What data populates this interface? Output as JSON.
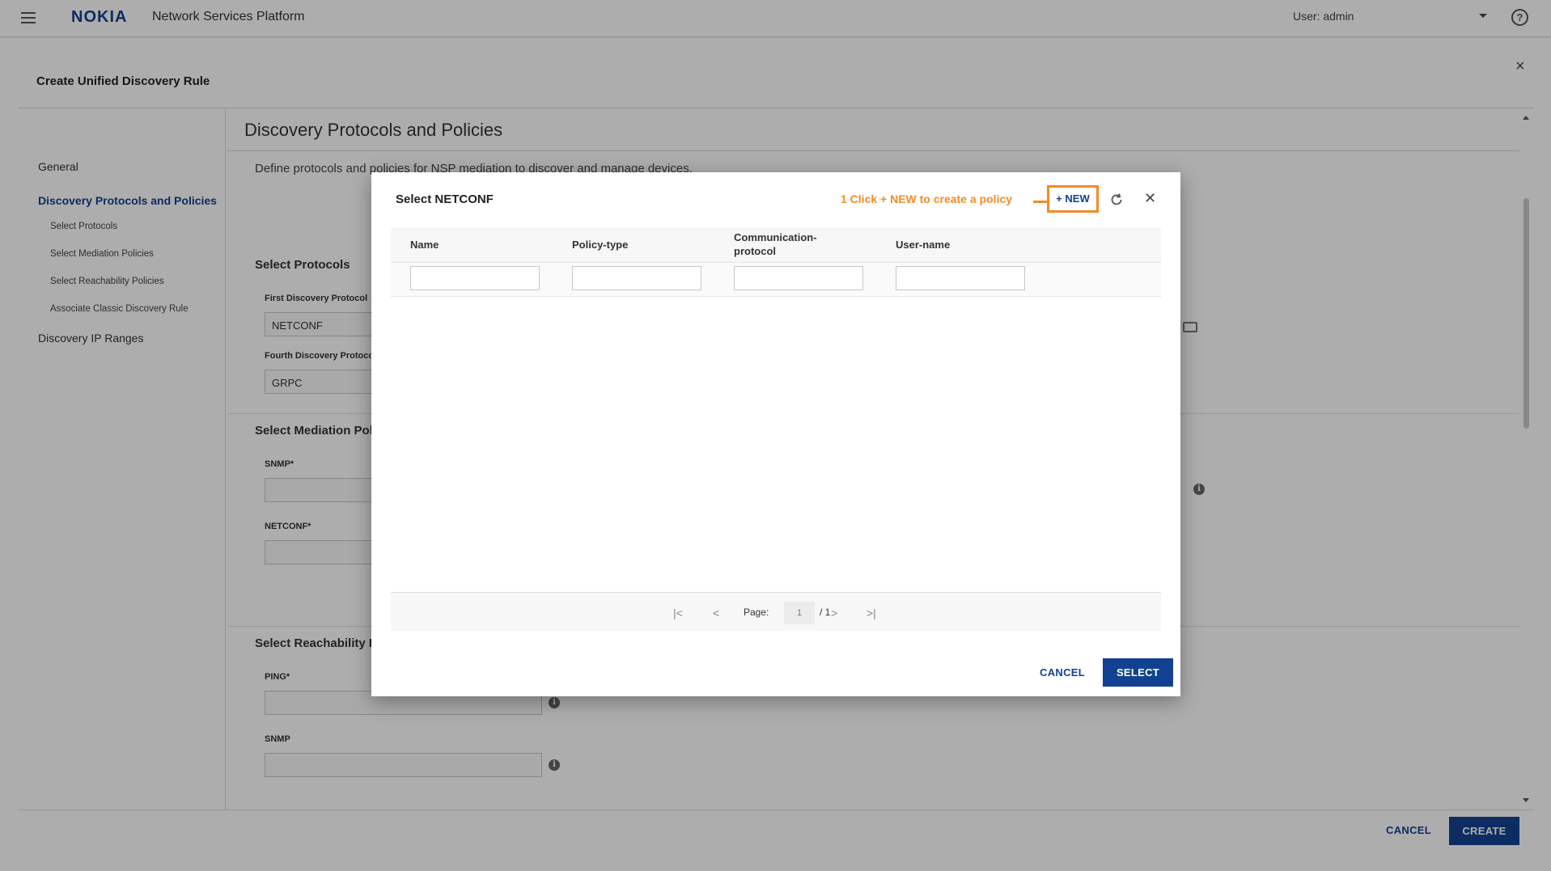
{
  "header": {
    "logo": "NOKIA",
    "app_title": "Network Services Platform",
    "user": "User: admin",
    "help": "?"
  },
  "dialog": {
    "title": "Create Unified Discovery Rule",
    "close": "×",
    "nav": {
      "general": "General",
      "protocols": "Discovery Protocols and Policies",
      "sub_select_protocols": "Select Protocols",
      "sub_mediation": "Select Mediation Policies",
      "sub_reachability": "Select Reachability Policies",
      "sub_classic": "Associate Classic Discovery Rule",
      "ip_ranges": "Discovery IP Ranges"
    },
    "section_title": "Discovery Protocols and Policies",
    "section_desc": "Define protocols and policies for NSP mediation to discover and manage devices.",
    "select_protocols": {
      "title": "Select Protocols",
      "first_label": "First Discovery Protocol",
      "first_value": "NETCONF",
      "fourth_label": "Fourth Discovery Protocol",
      "fourth_value": "GRPC"
    },
    "mediation": {
      "title": "Select Mediation Policies",
      "snmp_label": "SNMP*",
      "netconf_label": "NETCONF*"
    },
    "reachability": {
      "title": "Select Reachability Policies",
      "ping_label": "PING*",
      "snmp_label": "SNMP"
    },
    "footer": {
      "cancel": "CANCEL",
      "create": "CREATE"
    }
  },
  "modal": {
    "title": "Select  NETCONF",
    "callout": "1  Click + NEW to create a policy",
    "new_button": "+ NEW",
    "columns": [
      "Name",
      "Policy-type",
      "Communication-\nprotocol",
      "User-name"
    ],
    "pager": {
      "label": "Page:",
      "current": "1",
      "total": "/ 1"
    },
    "cancel": "CANCEL",
    "select": "SELECT"
  }
}
